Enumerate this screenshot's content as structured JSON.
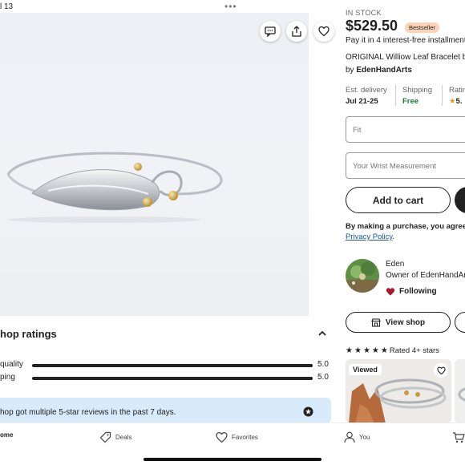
{
  "status_bar": {
    "time_fragment": "l 13",
    "menu_dots": "•••"
  },
  "hero": {
    "actions": [
      {
        "name": "message-icon"
      },
      {
        "name": "share-icon"
      },
      {
        "name": "heart-icon"
      }
    ]
  },
  "shop_ratings": {
    "title": "hop ratings",
    "rows": [
      {
        "label": "quality",
        "value": "5.0",
        "fill": 1.0
      },
      {
        "label": "ping",
        "value": "5.0",
        "fill": 1.0
      }
    ],
    "notice": "hop got multiple 5-star reviews in the past 7 days."
  },
  "product": {
    "stock": "IN STOCK",
    "price": "$529.50",
    "badge": "Bestseller",
    "installments": "Pay it in 4 interest-free installment",
    "title": "ORIGINAL Williow Leaf Bracelet by",
    "by_prefix": "by",
    "shop_name": "EdenHandArts"
  },
  "meta": {
    "delivery_label": "Est. delivery",
    "delivery_value": "Jul 21-25",
    "shipping_label": "Shipping",
    "shipping_value": "Free",
    "rating_label": "Ratin",
    "rating_value": "5."
  },
  "fields": {
    "fit_placeholder": "Fit",
    "wrist_placeholder": "Your Wrist Measurement"
  },
  "buttons": {
    "add_to_cart": "Add to cart",
    "view_shop": "View shop"
  },
  "purchase_note": {
    "line1": "By making a purchase, you agree",
    "link": "Privacy Policy",
    "period": "."
  },
  "seller": {
    "name": "Eden",
    "role": "Owner of EdenHandArt",
    "follow_label": "Following"
  },
  "recommendations": {
    "rated_label": "Rated 4+ stars",
    "viewed_chip": "Viewed"
  },
  "nav": {
    "home": "ome",
    "deals": "Deals",
    "favorites": "Favorites",
    "you": "You"
  },
  "colors": {
    "accent_green": "#177b38",
    "notice_blue": "#d7ebfa",
    "badge_peach": "#fdd3b8",
    "link_blue": "#1a57a9",
    "heart_red": "#a61a2e"
  }
}
